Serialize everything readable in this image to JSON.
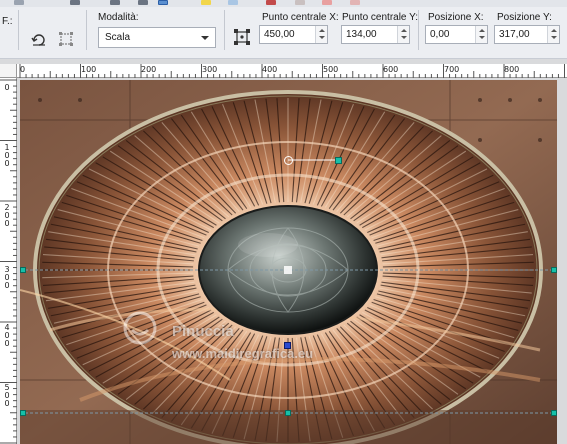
{
  "toolbar": {
    "cut_label": "F.:",
    "mode": {
      "label": "Modalità:",
      "value": "Scala"
    },
    "center_x": {
      "label": "Punto centrale X:",
      "value": "450,00"
    },
    "center_y": {
      "label": "Punto centrale Y:",
      "value": "134,00"
    },
    "pos_x": {
      "label": "Posizione X:",
      "value": "0,00"
    },
    "pos_y": {
      "label": "Posizione Y:",
      "value": "317,00"
    }
  },
  "ruler_top": {
    "ticks": [
      "0",
      "100",
      "200",
      "300",
      "400",
      "500",
      "600",
      "700",
      "800"
    ]
  },
  "ruler_left": {
    "ticks": [
      "0",
      "100",
      "200",
      "300",
      "400",
      "500"
    ]
  },
  "watermark": {
    "name": "Pinuccia",
    "site": "www.maidiregrafica.eu"
  },
  "colors": {
    "toolbar_bg": "#eceef2",
    "canvas_bg": "#d9dadc",
    "handle": "#16c0a8",
    "guide": "#5a7a8a"
  }
}
